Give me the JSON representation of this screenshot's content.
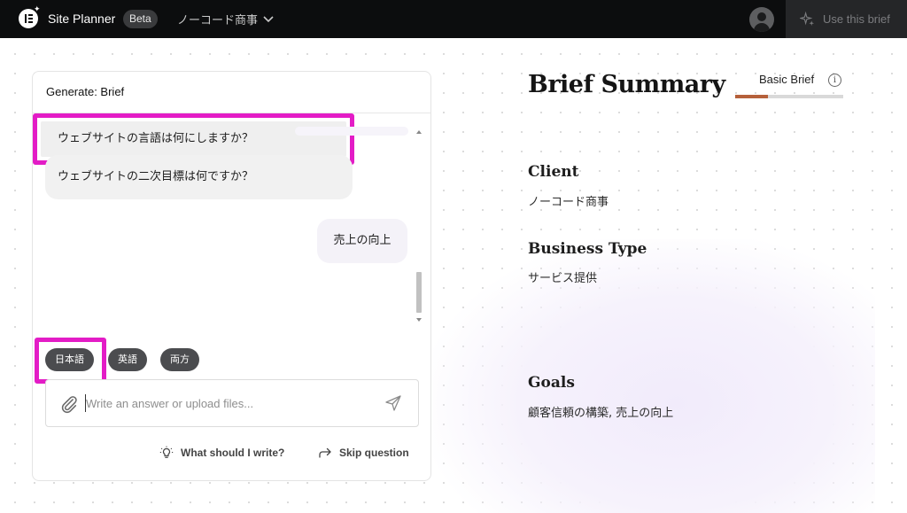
{
  "header": {
    "app_title": "Site Planner",
    "beta_badge": "Beta",
    "project_name": "ノーコード商事",
    "use_brief_label": "Use this brief"
  },
  "chat": {
    "panel_title": "Generate: Brief",
    "messages": [
      {
        "role": "bot",
        "text": "ウェブサイトの二次目標は何ですか？"
      },
      {
        "role": "user",
        "text": "売上の向上"
      },
      {
        "role": "bot",
        "text": "ウェブサイトの言語は何にしますか？"
      }
    ],
    "options": [
      "日本語",
      "英語",
      "両方"
    ],
    "input_placeholder": "Write an answer or upload files...",
    "hint_label": "What should I write?",
    "skip_label": "Skip question"
  },
  "summary": {
    "title": "Brief Summary",
    "brief_type": "Basic Brief",
    "info_glyph": "i",
    "progress": 0.3,
    "sections": [
      {
        "label": "Client",
        "value": "ノーコード商事"
      },
      {
        "label": "Business Type",
        "value": "サービス提供"
      },
      {
        "label": "Goals",
        "value": "顧客信頼の構築, 売上の向上"
      }
    ]
  },
  "colors": {
    "highlight": "#e31cc6",
    "progress_fill": "#b5603b",
    "topbar": "#0c0d0e"
  }
}
